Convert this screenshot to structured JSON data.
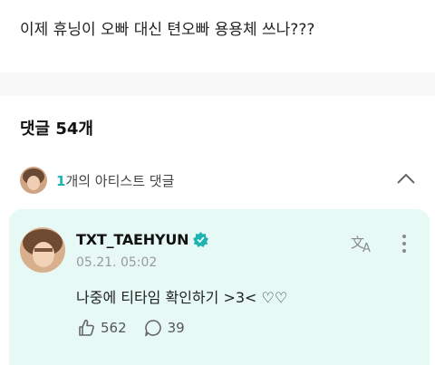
{
  "post": {
    "text": "이제 휴닝이 오빠 대신 텬오빠 용용체 쓰나???"
  },
  "comments": {
    "header": "댓글 54개"
  },
  "artist_comments": {
    "count": "1",
    "label": "개의 아티스트 댓글"
  },
  "comment": {
    "author": "TXT_TAEHYUN",
    "timestamp": "05.21. 05:02",
    "body": "나중에 티타임 확인하기 >3< ♡♡",
    "likes": "562",
    "replies": "39"
  },
  "colors": {
    "accent": "#1fb4b4",
    "card_bg": "#e6f9f5",
    "divider": "#f8f8f8"
  },
  "icons": [
    "chevron-up-icon",
    "verified-badge-icon",
    "translate-icon",
    "more-vertical-icon",
    "like-icon",
    "reply-icon"
  ]
}
